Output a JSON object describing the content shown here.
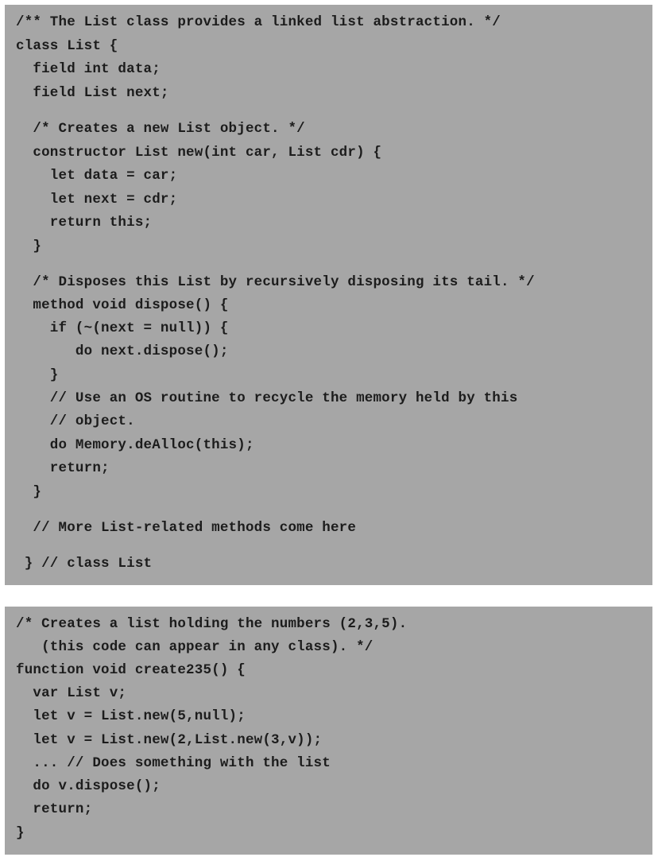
{
  "class_listing": {
    "lines": [
      "/** The List class provides a linked list abstraction. */",
      "class List {",
      "  field int data;",
      "  field List next;",
      "  /* Creates a new List object. */",
      "  constructor List new(int car, List cdr) {",
      "    let data = car;",
      "    let next = cdr;",
      "    return this;",
      "  }",
      "  /* Disposes this List by recursively disposing its tail. */",
      "  method void dispose() {",
      "    if (~(next = null)) {",
      "       do next.dispose();",
      "    }",
      "    // Use an OS routine to recycle the memory held by this",
      "    // object.",
      "    do Memory.deAlloc(this);",
      "    return;",
      "  }",
      "  // More List-related methods come here",
      " } // class List"
    ]
  },
  "function_listing": {
    "lines": [
      "/* Creates a list holding the numbers (2,3,5).",
      "   (this code can appear in any class). */",
      "function void create235() {",
      "  var List v;",
      "  let v = List.new(5,null);",
      "  let v = List.new(2,List.new(3,v));",
      "  ... // Does something with the list",
      "  do v.dispose();",
      "  return;",
      "}"
    ]
  }
}
